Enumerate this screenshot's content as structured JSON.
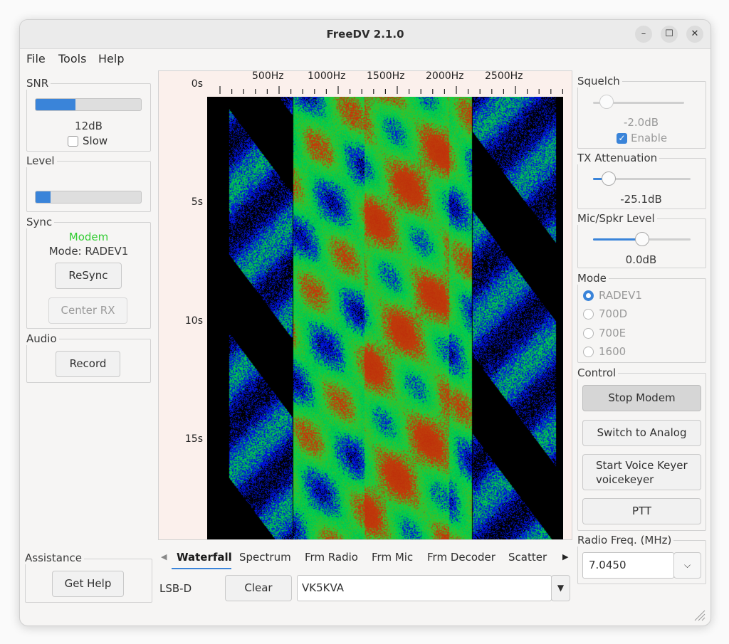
{
  "window": {
    "title": "FreeDV 2.1.0",
    "controls": [
      "–",
      "☐",
      "✕"
    ]
  },
  "menu": [
    "File",
    "Tools",
    "Help"
  ],
  "snr": {
    "label": "SNR",
    "value": "12dB",
    "level": 0.38,
    "slow_label": "Slow",
    "slow_checked": false
  },
  "level": {
    "label": "Level",
    "level": 0.14
  },
  "sync": {
    "label": "Sync",
    "status": "Modem",
    "status_color": "#33cc33",
    "mode": "Mode: RADEV1",
    "resync": "ReSync",
    "center_rx": "Center RX"
  },
  "audio": {
    "label": "Audio",
    "record": "Record"
  },
  "assistance": {
    "label": "Assistance",
    "get_help": "Get Help"
  },
  "waterfall": {
    "x_ticks": [
      "500Hz",
      "1000Hz",
      "1500Hz",
      "2000Hz",
      "2500Hz"
    ],
    "y_ticks": [
      "0s",
      "5s",
      "10s",
      "15s"
    ]
  },
  "tabs": [
    "Waterfall",
    "Spectrum",
    "Frm Radio",
    "Frm Mic",
    "Frm Decoder",
    "Scatter"
  ],
  "bottom": {
    "mode": "LSB-D",
    "clear": "Clear",
    "callsign": "VK5KVA"
  },
  "squelch": {
    "label": "Squelch",
    "value": "-2.0dB",
    "level": 0.15,
    "enable_label": "Enable",
    "enabled": true
  },
  "tx_attenuation": {
    "label": "TX Attenuation",
    "value": "-25.1dB",
    "level": 0.16
  },
  "mic_spkr": {
    "label": "Mic/Spkr Level",
    "value": "0.0dB",
    "level": 0.5
  },
  "mode": {
    "label": "Mode",
    "options": [
      "RADEV1",
      "700D",
      "700E",
      "1600"
    ],
    "selected": "RADEV1"
  },
  "control": {
    "label": "Control",
    "stop_modem": "Stop Modem",
    "switch_analog": "Switch to Analog",
    "voice_keyer_1": "Start Voice Keyer",
    "voice_keyer_2": "voicekeyer",
    "ptt": "PTT"
  },
  "radio_freq": {
    "label": "Radio Freq. (MHz)",
    "value": "7.0450"
  },
  "colors": {
    "accent": "#3a84d9",
    "sync_ok": "#33cc33"
  }
}
